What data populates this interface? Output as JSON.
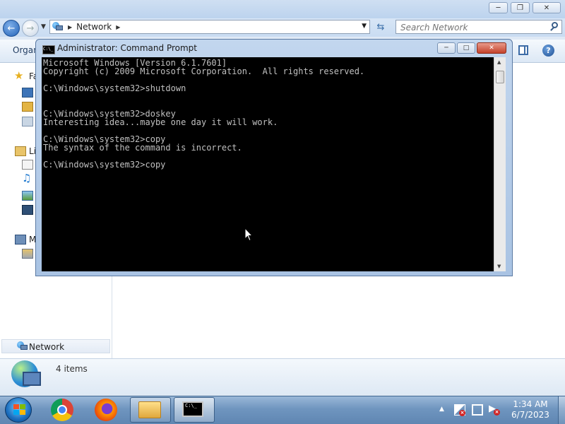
{
  "explorer": {
    "address": {
      "crumb": "Network"
    },
    "search": {
      "placeholder": "Search Network"
    },
    "toolbar": {
      "organize_label": "Organ"
    },
    "help": "?",
    "navpane": {
      "favorites_label": "Fa",
      "libraries_label": "Li",
      "computer_label": "M",
      "network_label": "Network"
    },
    "details": {
      "count": "4 items"
    }
  },
  "cmd": {
    "title": "Administrator: Command Prompt",
    "icon_text": "C:\\_",
    "lines": [
      "Microsoft Windows [Version 6.1.7601]",
      "Copyright (c) 2009 Microsoft Corporation.  All rights reserved.",
      "",
      "C:\\Windows\\system32>shutdown",
      "",
      "",
      "C:\\Windows\\system32>doskey",
      "Interesting idea...maybe one day it will work.",
      "",
      "C:\\Windows\\system32>copy",
      "The syntax of the command is incorrect.",
      "",
      "C:\\Windows\\system32>copy"
    ]
  },
  "taskbar": {
    "clock": {
      "time": "1:34 AM",
      "date": "6/7/2023"
    },
    "cmd_icon_text": "C:\\_"
  }
}
